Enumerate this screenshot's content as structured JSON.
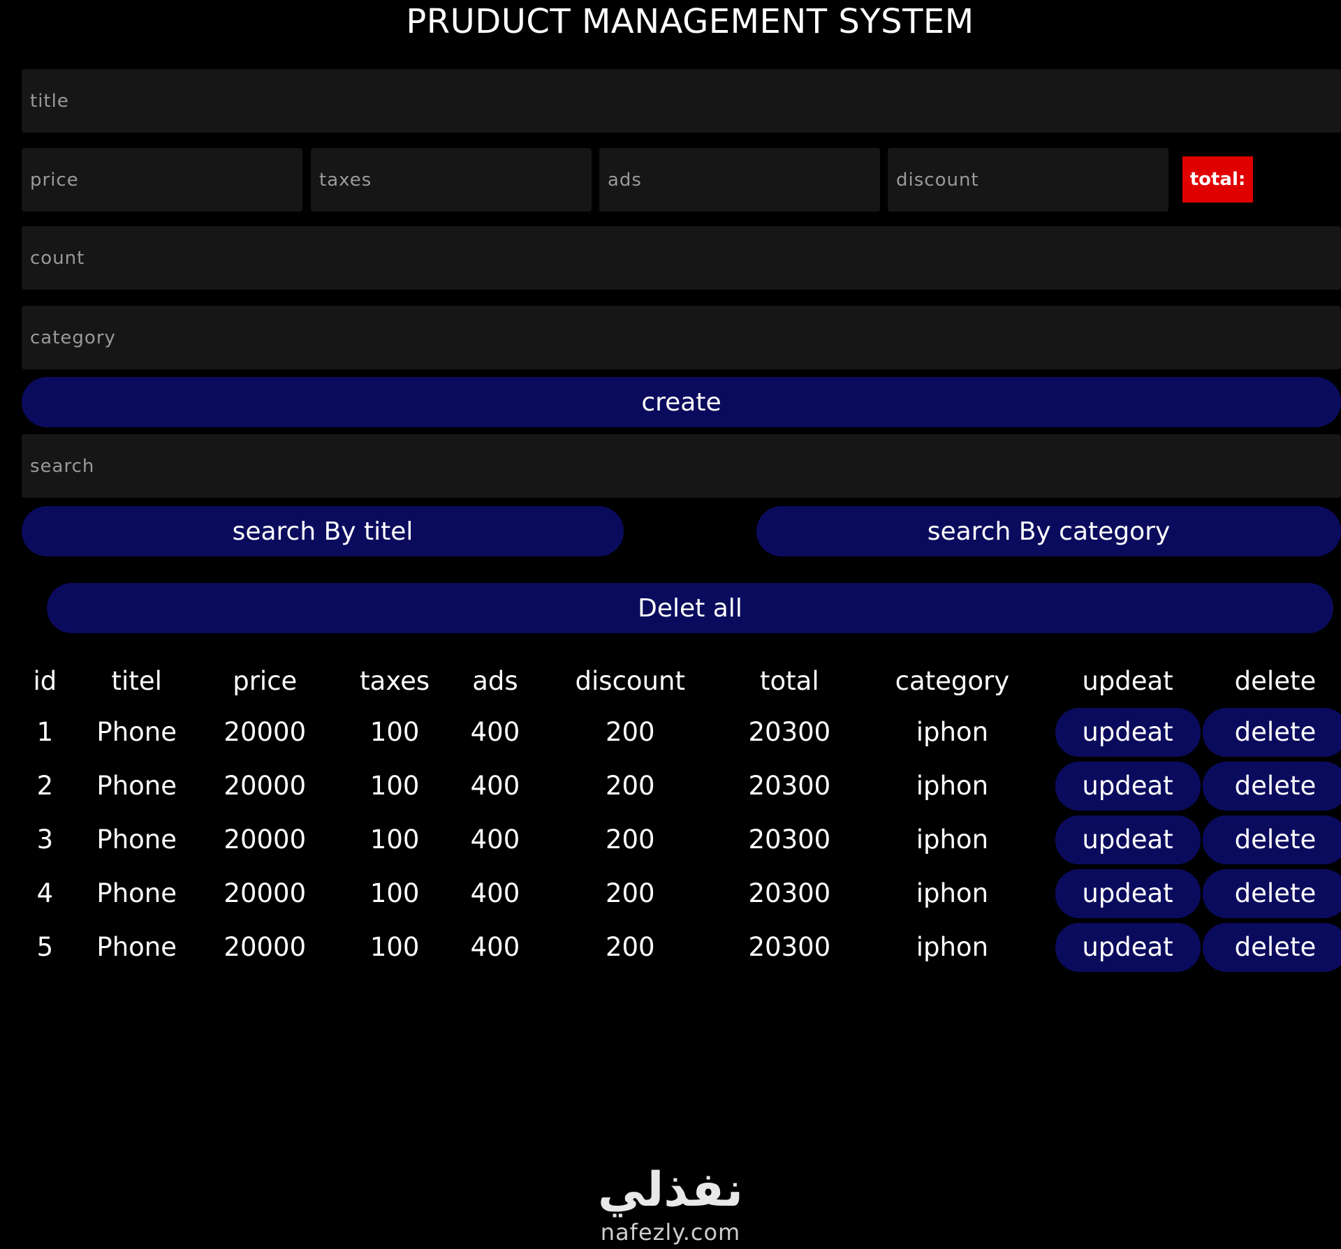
{
  "header": {
    "title": "PRUDUCT MANAGEMENT SYSTEM"
  },
  "form": {
    "title_placeholder": "title",
    "price_placeholder": "price",
    "taxes_placeholder": "taxes",
    "ads_placeholder": "ads",
    "discount_placeholder": "discount",
    "total_label": "total:",
    "count_placeholder": "count",
    "category_placeholder": "category",
    "create_label": "create"
  },
  "search": {
    "placeholder": "search",
    "by_title_label": "search By titel",
    "by_category_label": "search By category"
  },
  "actions": {
    "delete_all_label": "Delet all"
  },
  "table": {
    "headers": [
      "id",
      "titel",
      "price",
      "taxes",
      "ads",
      "discount",
      "total",
      "category",
      "updeat",
      "delete"
    ],
    "rows": [
      {
        "id": "1",
        "title": "Phone",
        "price": "20000",
        "taxes": "100",
        "ads": "400",
        "discount": "200",
        "total": "20300",
        "category": "iphon",
        "update_label": "updeat",
        "delete_label": "delete"
      },
      {
        "id": "2",
        "title": "Phone",
        "price": "20000",
        "taxes": "100",
        "ads": "400",
        "discount": "200",
        "total": "20300",
        "category": "iphon",
        "update_label": "updeat",
        "delete_label": "delete"
      },
      {
        "id": "3",
        "title": "Phone",
        "price": "20000",
        "taxes": "100",
        "ads": "400",
        "discount": "200",
        "total": "20300",
        "category": "iphon",
        "update_label": "updeat",
        "delete_label": "delete"
      },
      {
        "id": "4",
        "title": "Phone",
        "price": "20000",
        "taxes": "100",
        "ads": "400",
        "discount": "200",
        "total": "20300",
        "category": "iphon",
        "update_label": "updeat",
        "delete_label": "delete"
      },
      {
        "id": "5",
        "title": "Phone",
        "price": "20000",
        "taxes": "100",
        "ads": "400",
        "discount": "200",
        "total": "20300",
        "category": "iphon",
        "update_label": "updeat",
        "delete_label": "delete"
      }
    ]
  },
  "watermark": {
    "mark": "نفذلي",
    "domain": "nafezly.com"
  },
  "colors": {
    "background": "#000000",
    "input_bg": "#161616",
    "button_bg": "#0b0b5e",
    "total_badge": "#e00000",
    "text": "#ffffff",
    "placeholder": "#9a9a9a"
  }
}
